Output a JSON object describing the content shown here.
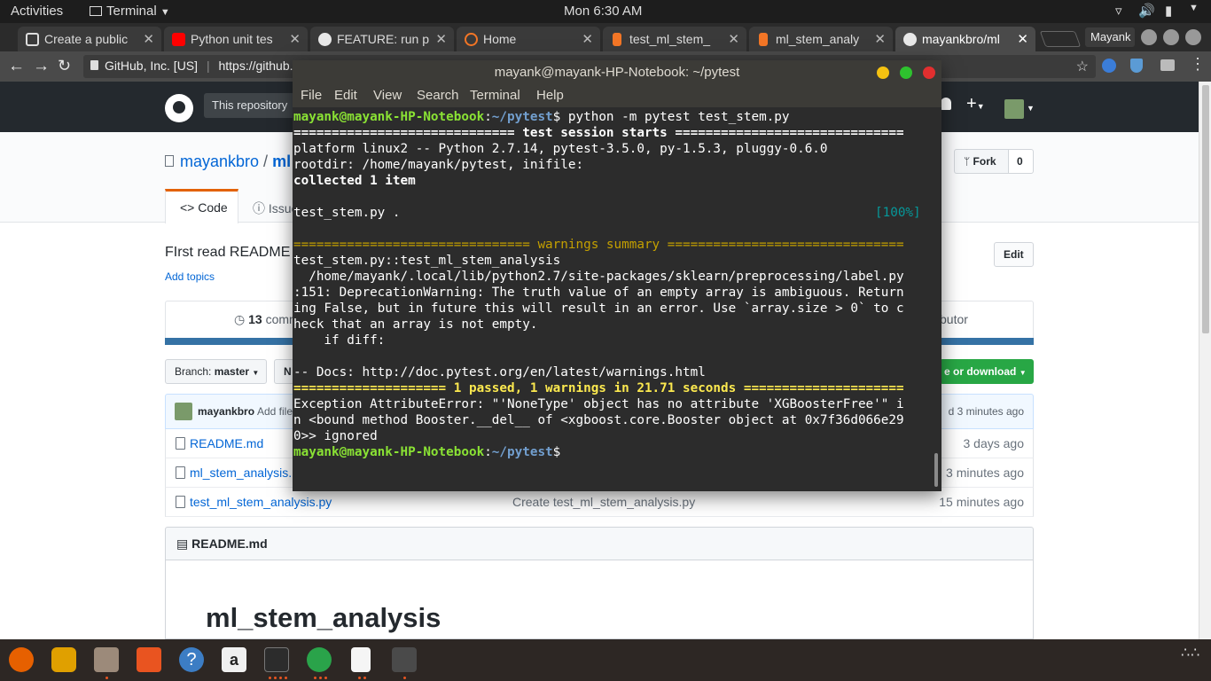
{
  "system_bar": {
    "activities": "Activities",
    "app_menu": "Terminal",
    "clock": "Mon  6:30 AM"
  },
  "browser": {
    "tabs": [
      {
        "label": "Create a public",
        "favicon_color": "#ffffff"
      },
      {
        "label": "Python unit tes",
        "favicon_color": "#ff0000"
      },
      {
        "label": "FEATURE: run p",
        "favicon_color": "#e8e8e8"
      },
      {
        "label": "Home",
        "favicon_color": "#f37626"
      },
      {
        "label": "test_ml_stem_",
        "favicon_color": "#f37626"
      },
      {
        "label": "ml_stem_analy",
        "favicon_color": "#f37626"
      },
      {
        "label": "mayankbro/ml",
        "favicon_color": "#e8e8e8"
      }
    ],
    "profile": "Mayank",
    "site_identity": "GitHub, Inc. [US]",
    "url": "https://github."
  },
  "github": {
    "search_scope": "This repository",
    "owner": "mayankbro",
    "repo": "ml",
    "fork_label": "Fork",
    "fork_count": "0",
    "tab_code": "Code",
    "tab_issues": "Issue",
    "description": "FIrst read README",
    "edit": "Edit",
    "add_topics": "Add topics",
    "commits_count": "13",
    "commits_label": "comm",
    "contributor": "butor",
    "branch_prefix": "Branch:",
    "branch": "master",
    "new_pr": "N",
    "clone": "e or download",
    "latest_user": "mayankbro",
    "latest_msg": "Add file",
    "latest_time": "d 3 minutes ago",
    "files": [
      {
        "name": "README.md",
        "msg": "",
        "age": "3 days ago"
      },
      {
        "name": "ml_stem_analysis.",
        "msg": "",
        "age": "3 minutes ago"
      },
      {
        "name": "test_ml_stem_analysis.py",
        "msg": "Create test_ml_stem_analysis.py",
        "age": "15 minutes ago"
      }
    ],
    "readme_header": "README.md",
    "readme_title": "ml_stem_analysis"
  },
  "terminal": {
    "title": "mayank@mayank-HP-Notebook: ~/pytest",
    "menu": [
      "File",
      "Edit",
      "View",
      "Search",
      "Terminal",
      "Help"
    ],
    "prompt_user": "mayank@mayank-HP-Notebook",
    "prompt_path": "~/pytest",
    "command": "python -m pytest test_stem.py",
    "l_session": "============================= test session starts ==============================",
    "l_platform": "platform linux2 -- Python 2.7.14, pytest-3.5.0, py-1.5.3, pluggy-0.6.0",
    "l_rootdir": "rootdir: /home/mayank/pytest, inifile:",
    "l_collected": "collected 1 item",
    "l_test": "test_stem.py .",
    "l_pct": "[100%]",
    "l_warn": "=============================== warnings summary ===============================",
    "l_w1": "test_stem.py::test_ml_stem_analysis",
    "l_w2": "  /home/mayank/.local/lib/python2.7/site-packages/sklearn/preprocessing/label.py",
    "l_w3": ":151: DeprecationWarning: The truth value of an empty array is ambiguous. Return",
    "l_w4": "ing False, but in future this will result in an error. Use `array.size > 0` to c",
    "l_w5": "heck that an array is not empty.",
    "l_w6": "    if diff:",
    "l_docs": "-- Docs: http://doc.pytest.org/en/latest/warnings.html",
    "l_passed": "==================== 1 passed, 1 warnings in 21.71 seconds =====================",
    "l_e1": "Exception AttributeError: \"'NoneType' object has no attribute 'XGBoosterFree'\" i",
    "l_e2": "n <bound method Booster.__del__ of <xgboost.core.Booster object at 0x7f36d066e29",
    "l_e3": "0>> ignored"
  },
  "dock": {
    "apps": [
      "firefox-icon",
      "rhythmbox-icon",
      "files-icon",
      "software-center-icon",
      "help-icon",
      "amazon-icon",
      "terminal-icon",
      "chrome-icon",
      "text-editor-icon",
      "sublime-icon"
    ],
    "colors": {
      "firefox": "#e66000",
      "rhythmbox": "#e0a000",
      "files": "#9c8a7a",
      "software": "#e95420",
      "help": "#3c7dc4",
      "amazon": "#f0f0f0",
      "terminal": "#2c2c2c",
      "chrome": "#2aa34a",
      "text": "#f5f5f5",
      "sublime": "#4a4a4a"
    }
  }
}
